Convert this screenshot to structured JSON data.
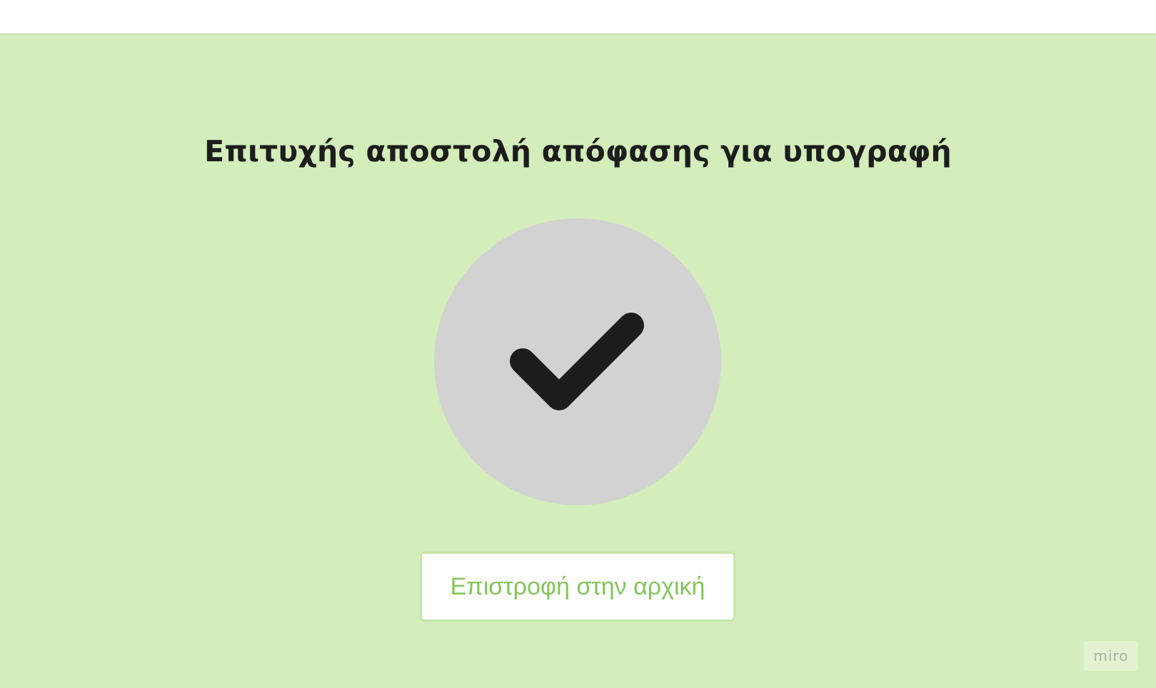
{
  "page": {
    "title": "Επιτυχής αποστολή απόφασης για υπογραφή"
  },
  "status_icon": {
    "name": "checkmark-icon",
    "circle_color": "#d2d2d2",
    "check_color": "#1d1d1d"
  },
  "actions": {
    "home_label": "Επιστροφή στην αρχική"
  },
  "watermark": {
    "text": "miro"
  },
  "colors": {
    "background": "#d3edbb",
    "button_text": "#84c65a",
    "button_border": "#c6e6a8"
  }
}
